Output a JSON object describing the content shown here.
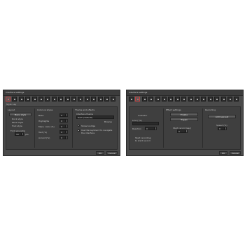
{
  "left": {
    "title": "Interface settings",
    "tab_count": 17,
    "active_tab": 0,
    "sub_tabs": [
      "Style",
      "Lay"
    ],
    "sections": {
      "first": {
        "header": "Layout",
        "items": [
          "Menu style",
          "Dock style",
          "Panel style",
          "Font style"
        ],
        "spin_label": "Font size (pts)",
        "spin_value": "10",
        "spin_unit": "pts"
      },
      "second": {
        "header": "Colors & styles",
        "rows": [
          {
            "label": "Base",
            "value": "0"
          },
          {
            "label": "Highlights",
            "value": "0"
          },
          {
            "label": "Menu color (%)",
            "value": "0"
          },
          {
            "label": "Text (%)",
            "value": "0"
          },
          {
            "label": "Accent (%)",
            "value": "0"
          }
        ]
      },
      "third": {
        "header": "Theme and effects",
        "field_label": "Interface theme",
        "field_value": "Dark (default)",
        "link": "Browse",
        "check_label": "Show tooltips",
        "note": "Use the keyboard to navigate the interface"
      }
    },
    "ok_label": "OK",
    "cancel_label": "Cancel"
  },
  "right": {
    "title": "Interface settings",
    "tab_count": 17,
    "active_tab": 1,
    "sections": {
      "first": {
        "label1": "Indicator",
        "field_label": "Line (°/s)",
        "field_value": "",
        "combo_label": "Reaction",
        "combo_value": "0",
        "bottom_text1": "Start recording",
        "bottom_text2": "to start record"
      },
      "second": {
        "header": "Effect settings",
        "btn1": "Enable",
        "btn2": "Toggle",
        "spin_label": "Start record (sec)",
        "spin_value": "0"
      },
      "third": {
        "header": "Recording",
        "btn": "Add new set",
        "spin_label": "Speed (%)",
        "spin_value": "0"
      }
    },
    "ok_label": "OK",
    "cancel_label": "Cancel"
  }
}
